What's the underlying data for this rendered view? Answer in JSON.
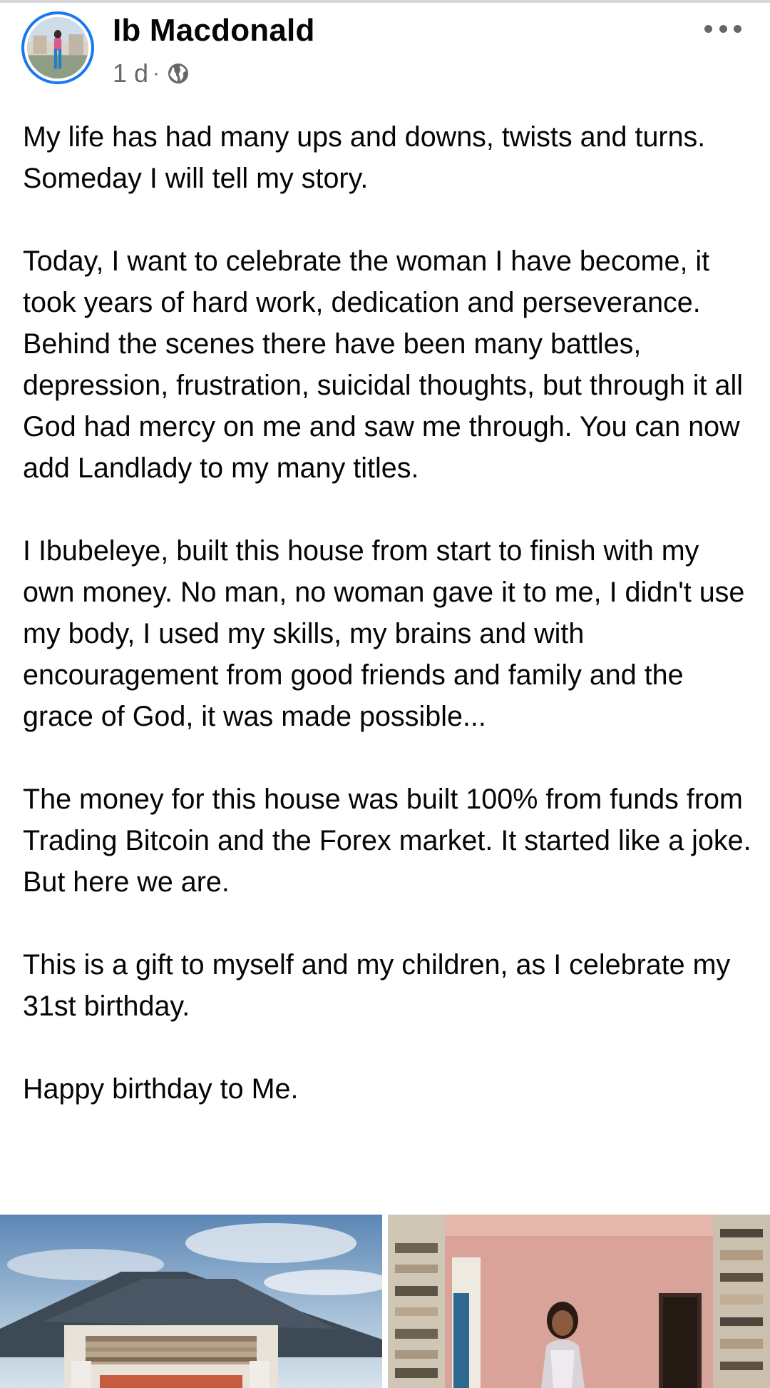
{
  "post": {
    "author": "Ib Macdonald",
    "time": "1 d",
    "separator": "·",
    "privacy_icon": "globe-icon",
    "more_icon": "more-horizontal-icon",
    "paragraphs": [
      "My life has had many ups and downs, twists and turns. Someday I will tell my story.",
      "Today, I want to celebrate the woman I have become, it took years of hard work, dedication and perseverance. Behind the scenes there have been many battles, depression, frustration, suicidal thoughts, but through it all God had mercy on me and saw me through.  You can now add Landlady to my many titles.",
      "I Ibubeleye, built this house from start to finish with my own money. No man, no woman gave it to me, I didn't use my body, I used my skills, my brains and with encouragement from good friends and family and the grace of God, it was made possible...",
      "The money for this house was built 100% from funds from Trading Bitcoin and the Forex market. It started like a joke. But here we are.",
      "This is a gift to myself and my children, as I celebrate my 31st birthday.",
      "Happy birthday to Me."
    ]
  },
  "colors": {
    "text": "#050505",
    "secondary_text": "#65676b",
    "avatar_ring": "#1877f2",
    "divider": "#d6d8dc"
  }
}
